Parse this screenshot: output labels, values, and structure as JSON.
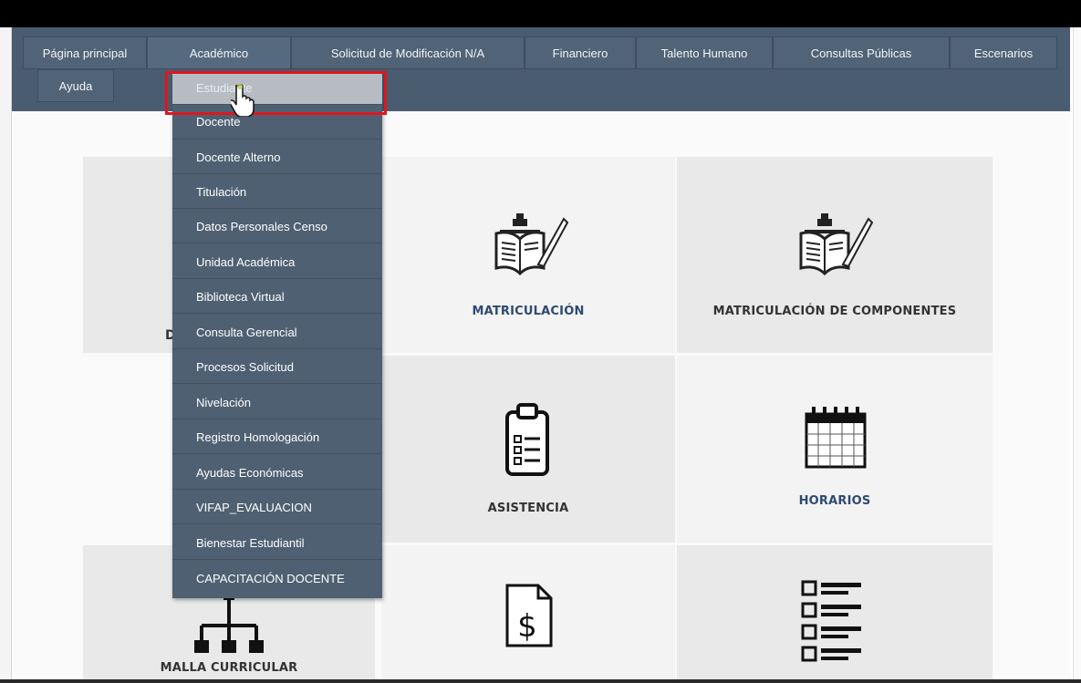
{
  "nav": {
    "items": [
      {
        "label": "Página principal"
      },
      {
        "label": "Académico"
      },
      {
        "label": "Solicitud de Modificación N/A"
      },
      {
        "label": "Financiero"
      },
      {
        "label": "Talento Humano"
      },
      {
        "label": "Consultas Públicas"
      },
      {
        "label": "Escenarios"
      },
      {
        "label": "Ayuda"
      }
    ]
  },
  "dropdown": {
    "parent": "Académico",
    "hovered_item": "Estudiante",
    "items": [
      {
        "label": "Estudiante"
      },
      {
        "label": "Docente"
      },
      {
        "label": "Docente Alterno"
      },
      {
        "label": "Titulación"
      },
      {
        "label": "Datos Personales Censo"
      },
      {
        "label": "Unidad Académica"
      },
      {
        "label": "Biblioteca Virtual"
      },
      {
        "label": "Consulta Gerencial"
      },
      {
        "label": "Procesos Solicitud"
      },
      {
        "label": "Nivelación"
      },
      {
        "label": "Registro Homologación"
      },
      {
        "label": "Ayudas Económicas"
      },
      {
        "label": "VIFAP_EVALUACION"
      },
      {
        "label": "Bienestar Estudiantil"
      },
      {
        "label": "CAPACITACIÓN DOCENTE"
      }
    ]
  },
  "tiles": {
    "matriculacion": {
      "label": "MATRICULACIÓN",
      "icon": "book-pen-icon"
    },
    "matriculacion_componentes": {
      "label": "MATRICULACIÓN DE COMPONENTES",
      "icon": "book-pen-icon"
    },
    "asistencia": {
      "label": "ASISTENCIA",
      "icon": "clipboard-checklist-icon"
    },
    "horarios": {
      "label": "HORARIOS",
      "icon": "calendar-icon"
    },
    "malla_curricular": {
      "label": "MALLA CURRICULAR",
      "icon": "org-chart-icon"
    },
    "pagos": {
      "label": "",
      "icon": "dollar-document-icon"
    },
    "listado": {
      "label": "",
      "icon": "checklist-icon"
    },
    "hidden_partial_char": "D"
  },
  "colors": {
    "nav_bg": "#4a5c70",
    "menu_bg": "#4f6072",
    "highlight": "#e0161d",
    "label_blue": "#2c4a73",
    "label_dark": "#333333"
  }
}
